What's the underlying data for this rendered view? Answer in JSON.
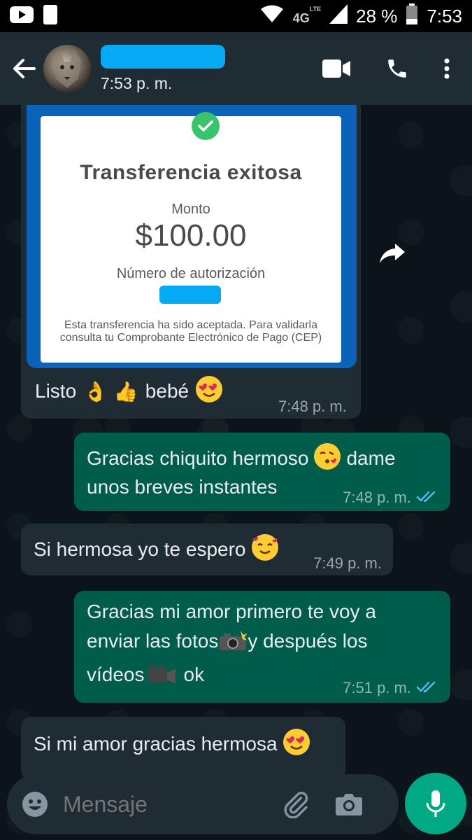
{
  "status_bar": {
    "network": "4G",
    "network_sub": "LTE",
    "battery": "28 %",
    "time": "7:53"
  },
  "header": {
    "last_seen": "7:53 p. m."
  },
  "receipt": {
    "title": "Transferencia exitosa",
    "amount_label": "Monto",
    "amount": "$100.00",
    "auth_label": "Número de autorización",
    "note": "Esta transferencia ha sido aceptada. Para validarla consulta tu Comprobante Electrónico de Pago (CEP)"
  },
  "messages": [
    {
      "direction": "in",
      "text": "Listo",
      "emojis": "👌 👍",
      "text2": "bebé",
      "time": "7:48 p. m."
    },
    {
      "direction": "out",
      "line1": "Gracias chiquito hermoso",
      "line1b": "dame",
      "line2": "unos breves instantes",
      "time": "7:48 p. m."
    },
    {
      "direction": "in",
      "text": "Si hermosa yo te espero",
      "time": "7:49 p. m."
    },
    {
      "direction": "out",
      "line1": "Gracias mi amor primero te voy a",
      "line2a": "enviar las fotos",
      "line2b": "y después los",
      "line3a": "vídeos",
      "line3b": "ok",
      "time": "7:51 p. m."
    },
    {
      "direction": "in",
      "text": "Si mi amor gracias hermosa"
    }
  ],
  "input": {
    "placeholder": "Mensaje"
  },
  "colors": {
    "header_bg": "#1f2c34",
    "incoming_bubble": "#1f2c34",
    "outgoing_bubble": "#005c4b",
    "accent": "#00a884",
    "read_ticks": "#53bdeb"
  },
  "icons": [
    "youtube-icon",
    "moon-icon",
    "wifi-icon",
    "signal-icon",
    "battery-icon",
    "back-arrow-icon",
    "video-call-icon",
    "phone-icon",
    "more-icon",
    "check-icon",
    "share-icon",
    "emoji-icon",
    "attach-icon",
    "camera-icon",
    "mic-icon"
  ]
}
